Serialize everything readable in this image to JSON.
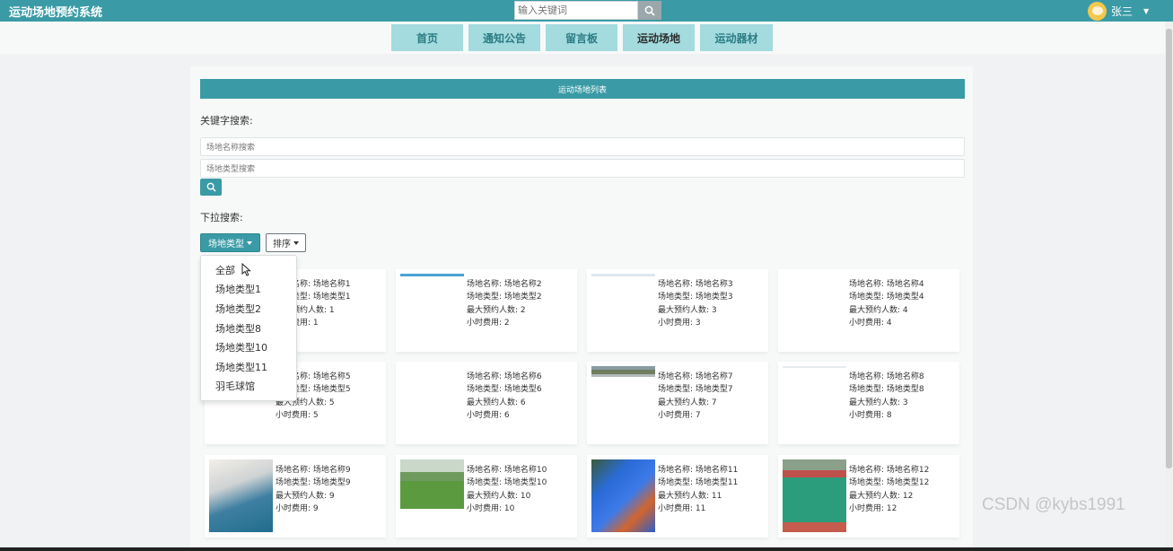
{
  "header": {
    "brand": "运动场地预约系统",
    "search_placeholder": "输入关键词",
    "user_name": "张三"
  },
  "nav": {
    "items": [
      "首页",
      "通知公告",
      "留言板",
      "运动场地",
      "运动器材"
    ],
    "active_index": 3
  },
  "panel": {
    "title": "运动场地列表",
    "keyword_label": "关键字搜索:",
    "name_placeholder": "场地名称搜索",
    "type_placeholder": "场地类型搜索",
    "dropdown_label": "下拉搜索:",
    "type_button": "场地类型",
    "sort_button": "排序"
  },
  "dropdown_menu": [
    "全部",
    "场地类型1",
    "场地类型2",
    "场地类型8",
    "场地类型10",
    "场地类型11",
    "羽毛球馆"
  ],
  "field_labels": {
    "name": "场地名称: ",
    "type": "场地类型: ",
    "max": "最大预约人数: ",
    "fee": "小时费用: "
  },
  "venues": [
    {
      "name": "场地名称1",
      "type": "场地类型1",
      "max": "1",
      "fee": "1"
    },
    {
      "name": "场地名称2",
      "type": "场地类型2",
      "max": "2",
      "fee": "2"
    },
    {
      "name": "场地名称3",
      "type": "场地类型3",
      "max": "3",
      "fee": "3"
    },
    {
      "name": "场地名称4",
      "type": "场地类型4",
      "max": "4",
      "fee": "4"
    },
    {
      "name": "场地名称5",
      "type": "场地类型5",
      "max": "5",
      "fee": "5"
    },
    {
      "name": "场地名称6",
      "type": "场地类型6",
      "max": "6",
      "fee": "6"
    },
    {
      "name": "场地名称7",
      "type": "场地类型7",
      "max": "7",
      "fee": "7"
    },
    {
      "name": "场地名称8",
      "type": "场地类型8",
      "max": "3",
      "fee": "8"
    },
    {
      "name": "场地名称9",
      "type": "场地类型9",
      "max": "9",
      "fee": "9"
    },
    {
      "name": "场地名称10",
      "type": "场地类型10",
      "max": "10",
      "fee": "10"
    },
    {
      "name": "场地名称11",
      "type": "场地类型11",
      "max": "11",
      "fee": "11"
    },
    {
      "name": "场地名称12",
      "type": "场地类型12",
      "max": "12",
      "fee": "12"
    }
  ],
  "watermark": "CSDN @kybs1991",
  "colors": {
    "primary": "#3a9ba6",
    "nav_tab": "#a3dbde"
  }
}
